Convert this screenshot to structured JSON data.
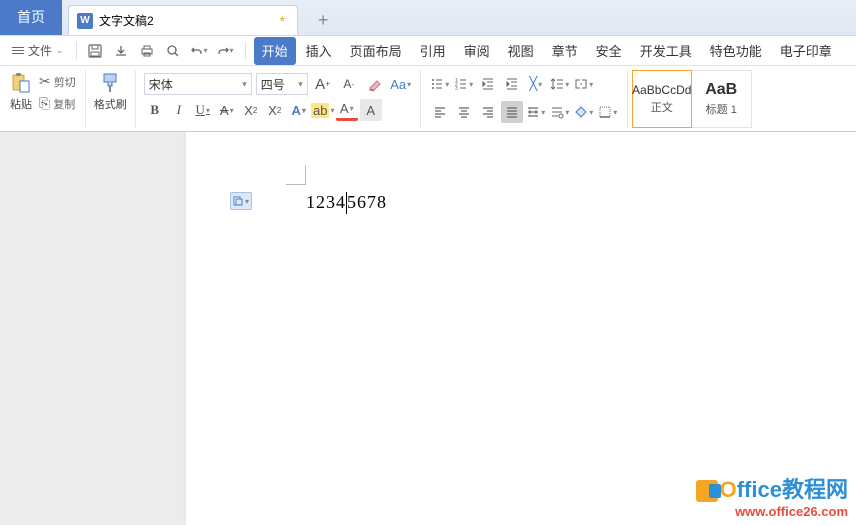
{
  "tabs": {
    "home": "首页",
    "doc_name": "文字文稿2",
    "doc_icon": "W",
    "dirty": "*",
    "new": "+"
  },
  "menu": {
    "file": "文件",
    "items": [
      "开始",
      "插入",
      "页面布局",
      "引用",
      "审阅",
      "视图",
      "章节",
      "安全",
      "开发工具",
      "特色功能",
      "电子印章"
    ]
  },
  "ribbon": {
    "clipboard": {
      "paste": "粘贴",
      "cut": "剪切",
      "copy": "复制",
      "format_painter": "格式刷"
    },
    "font": {
      "name": "宋体",
      "size": "四号"
    },
    "styles": {
      "normal_preview": "AaBbCcDd",
      "normal_label": "正文",
      "heading_preview": "AaB",
      "heading_label": "标题 1"
    }
  },
  "document": {
    "text_before": "1234",
    "text_after": "5678"
  },
  "watermark": {
    "brand": "Office教程网",
    "url": "www.office26.com"
  }
}
